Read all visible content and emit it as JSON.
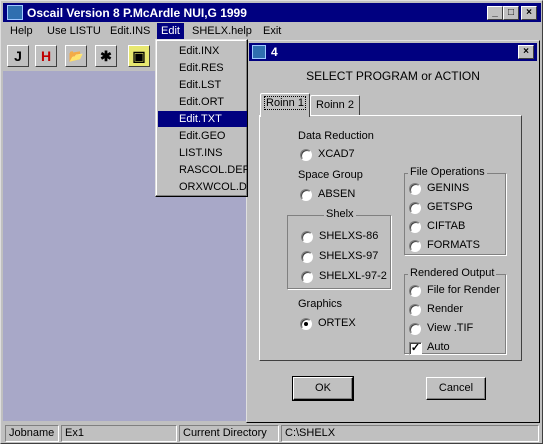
{
  "window": {
    "title": "Oscail Version 8 P.McArdle NUI,G 1999",
    "min_glyph": "_",
    "max_glyph": "□",
    "close_glyph": "×"
  },
  "menubar": [
    "Help",
    "Use LISTU",
    "Edit.INS",
    "Edit",
    "SHELX.help",
    "Exit"
  ],
  "toolbar": {
    "t1": "J",
    "t2": "H",
    "t3": "📂",
    "t4": "✱",
    "t5": "▣"
  },
  "edit_menu": [
    "Edit.INX",
    "Edit.RES",
    "Edit.LST",
    "Edit.ORT",
    "Edit.TXT",
    "Edit.GEO",
    "LIST.INS",
    "RASCOL.DEF",
    "ORXWCOL.DEF"
  ],
  "dialog": {
    "title": "4",
    "close_glyph": "×",
    "heading": "SELECT PROGRAM or ACTION",
    "tabs": [
      "Roinn 1",
      "Roinn 2"
    ],
    "data_reduction": {
      "label": "Data Reduction",
      "options": [
        "XCAD7"
      ]
    },
    "space_group": {
      "label": "Space Group",
      "options": [
        "ABSEN"
      ]
    },
    "shelx": {
      "label": "Shelx",
      "options": [
        "SHELXS-86",
        "SHELXS-97",
        "SHELXL-97-2"
      ]
    },
    "graphics": {
      "label": "Graphics",
      "options": [
        "ORTEX"
      ],
      "selected": "ORTEX"
    },
    "file_ops": {
      "label": "File Operations",
      "options": [
        "GENINS",
        "GETSPG",
        "CIFTAB",
        "FORMATS"
      ]
    },
    "rendered": {
      "label": "Rendered Output",
      "options": [
        "File for Render",
        "Render",
        "View .TIF"
      ],
      "auto_label": "Auto",
      "auto_checked": true
    },
    "check_glyph": "✓",
    "ok_label": "OK",
    "cancel_label": "Cancel"
  },
  "status": {
    "jobname_label": "Jobname",
    "jobname_value": "Ex1",
    "dir_label": "Current Directory",
    "dir_value": "C:\\SHELX"
  }
}
